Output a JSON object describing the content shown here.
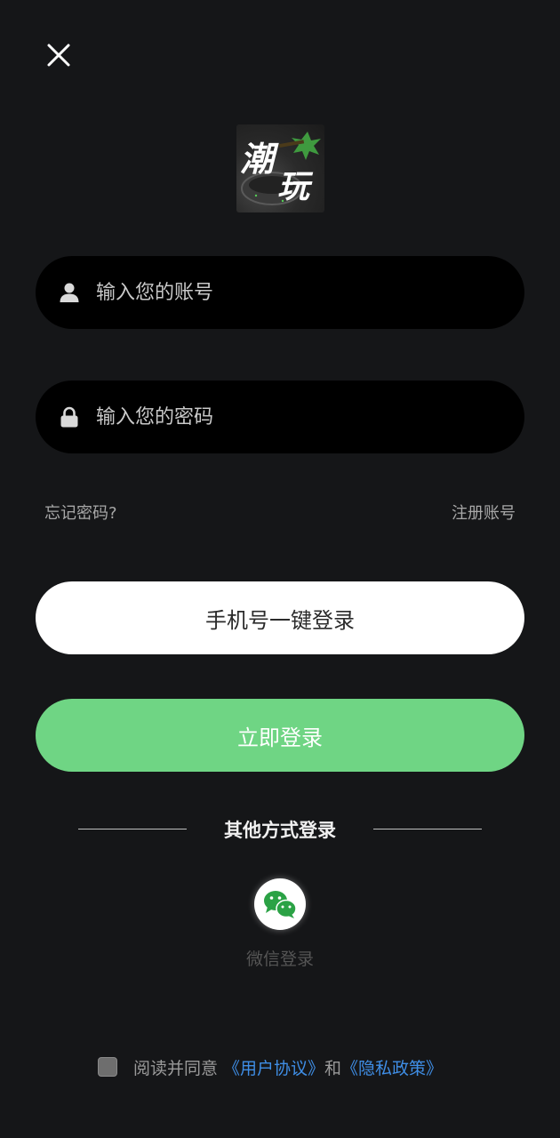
{
  "header": {
    "close_icon": "close-icon"
  },
  "logo": {
    "text_line1": "潮",
    "text_line2": "玩"
  },
  "account": {
    "placeholder": "输入您的账号",
    "icon": "user-icon"
  },
  "password": {
    "placeholder": "输入您的密码",
    "icon": "lock-icon"
  },
  "links": {
    "forgot": "忘记密码?",
    "register": "注册账号"
  },
  "buttons": {
    "phone_login": "手机号一键登录",
    "login": "立即登录"
  },
  "other": {
    "title": "其他方式登录",
    "wechat_label": "微信登录",
    "wechat_icon": "wechat-icon"
  },
  "agreement": {
    "prefix": "阅读并同意",
    "user_agreement": "《用户协议》",
    "and": "和",
    "privacy_policy": "《隐私政策》",
    "checked": false
  },
  "colors": {
    "background": "#151618",
    "field_bg": "#000000",
    "primary_green": "#6fd584",
    "link_blue": "#3f8ee6",
    "wechat_green": "#2ba245"
  }
}
